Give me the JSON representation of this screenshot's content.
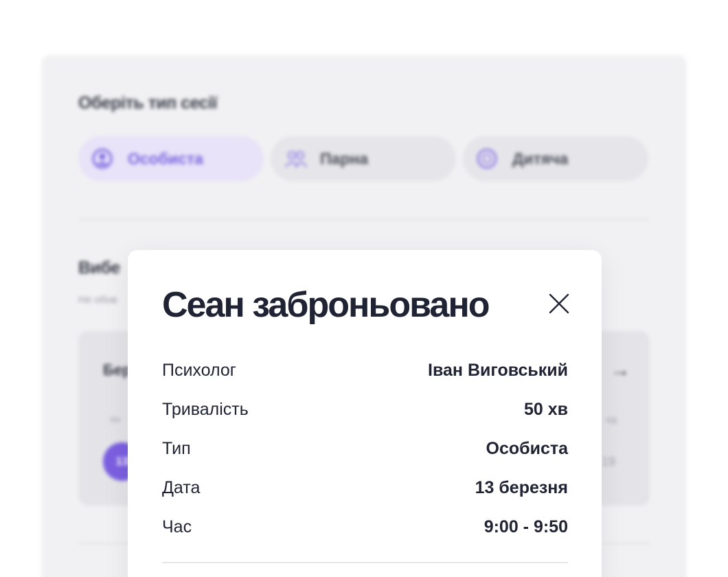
{
  "background": {
    "session_type_title": "Оберіть тип сесії",
    "session_types": [
      {
        "label": "Особиста",
        "icon": "person-icon",
        "active": true
      },
      {
        "label": "Парна",
        "icon": "couple-icon",
        "active": false
      },
      {
        "label": "Дитяча",
        "icon": "child-icon",
        "active": false
      }
    ],
    "second_title": "Вибе",
    "hint": "Не обов",
    "calendar": {
      "month": "Бер",
      "weekday_left": "пн",
      "weekday_right": "нд",
      "selected_day": "13",
      "right_day": "19"
    },
    "accent_color": "#7b5fe0"
  },
  "modal": {
    "title": "Сеан заброньовано",
    "close_icon": "close-icon",
    "details": [
      {
        "label": "Психолог",
        "value": "Іван Виговський"
      },
      {
        "label": "Тривалість",
        "value": "50 хв"
      },
      {
        "label": "Тип",
        "value": "Особиста"
      },
      {
        "label": "Дата",
        "value": "13 березня"
      },
      {
        "label": "Час",
        "value": "9:00 - 9:50"
      }
    ]
  }
}
